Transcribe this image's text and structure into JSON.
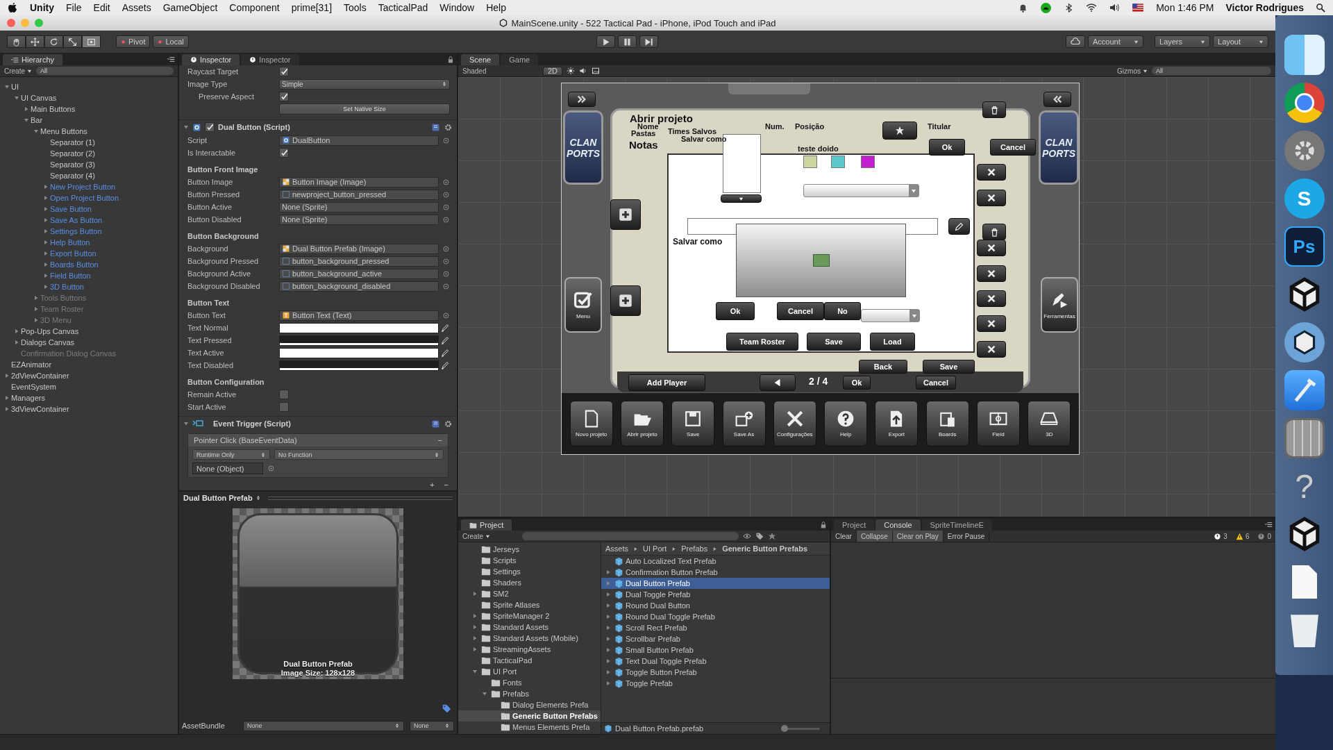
{
  "menubar": {
    "app": "Unity",
    "menus": [
      "File",
      "Edit",
      "Assets",
      "GameObject",
      "Component",
      "prime[31]",
      "Tools",
      "TacticalPad",
      "Window",
      "Help"
    ],
    "clock": "Mon 1:46 PM",
    "user": "Victor Rodrigues"
  },
  "window": {
    "title": "MainScene.unity - 522 Tactical Pad - iPhone, iPod Touch and iPad"
  },
  "toolbar": {
    "tools": [
      {
        "kind": "hand",
        "selected": false
      },
      {
        "kind": "move",
        "selected": false
      },
      {
        "kind": "rotate",
        "selected": false
      },
      {
        "kind": "scale",
        "selected": false
      },
      {
        "kind": "rect",
        "selected": true
      }
    ],
    "pivot": "Pivot",
    "space": "Local",
    "account": "Account",
    "layers": "Layers",
    "layout": "Layout"
  },
  "hierarchy": {
    "tab": "Hierarchy",
    "create": "Create",
    "search_placeholder": "All",
    "items": [
      {
        "label": "UI",
        "kind": "normal",
        "expanded": true,
        "children": [
          {
            "label": "UI Canvas",
            "kind": "normal",
            "expanded": true,
            "children": [
              {
                "label": "Main Buttons",
                "kind": "normal",
                "expanded": false
              },
              {
                "label": "Bar",
                "kind": "normal",
                "expanded": true,
                "children": [
                  {
                    "label": "Menu Buttons",
                    "kind": "normal",
                    "expanded": true,
                    "children": [
                      {
                        "label": "Separator (1)",
                        "kind": "normal"
                      },
                      {
                        "label": "Separator (2)",
                        "kind": "normal"
                      },
                      {
                        "label": "Separator (3)",
                        "kind": "normal"
                      },
                      {
                        "label": "Separator (4)",
                        "kind": "normal"
                      },
                      {
                        "label": "New Project Button",
                        "kind": "prefab",
                        "expanded": false
                      },
                      {
                        "label": "Open Project Button",
                        "kind": "prefab",
                        "expanded": false
                      },
                      {
                        "label": "Save Button",
                        "kind": "prefab",
                        "expanded": false
                      },
                      {
                        "label": "Save As Button",
                        "kind": "prefab",
                        "expanded": false
                      },
                      {
                        "label": "Settings Button",
                        "kind": "prefab",
                        "expanded": false
                      },
                      {
                        "label": "Help Button",
                        "kind": "prefab",
                        "expanded": false
                      },
                      {
                        "label": "Export Button",
                        "kind": "prefab",
                        "expanded": false
                      },
                      {
                        "label": "Boards Button",
                        "kind": "prefab",
                        "expanded": false
                      },
                      {
                        "label": "Field Button",
                        "kind": "prefab",
                        "expanded": false
                      },
                      {
                        "label": "3D Button",
                        "kind": "prefab",
                        "expanded": false
                      }
                    ]
                  },
                  {
                    "label": "Tools Buttons",
                    "kind": "inactive",
                    "expanded": false
                  },
                  {
                    "label": "Team Roster",
                    "kind": "inactive",
                    "expanded": false
                  },
                  {
                    "label": "3D Menu",
                    "kind": "inactive",
                    "expanded": false
                  }
                ]
              }
            ]
          },
          {
            "label": "Pop-Ups Canvas",
            "kind": "normal",
            "expanded": false
          },
          {
            "label": "Dialogs Canvas",
            "kind": "normal",
            "expanded": false
          },
          {
            "label": "Confirmation Dialog Canvas",
            "kind": "inactive"
          }
        ]
      },
      {
        "label": "EZAnimator",
        "kind": "normal"
      },
      {
        "label": "2dViewContainer",
        "kind": "normal",
        "expanded": false
      },
      {
        "label": "EventSystem",
        "kind": "normal"
      },
      {
        "label": "Managers",
        "kind": "normal",
        "expanded": false
      },
      {
        "label": "3dViewContainer",
        "kind": "normal",
        "expanded": false
      }
    ]
  },
  "inspector": {
    "tabs": [
      {
        "label": "Inspector",
        "selected": true
      },
      {
        "label": "Inspector",
        "selected": false
      }
    ],
    "image_rows": [
      {
        "kind": "check",
        "label": "Raycast Target",
        "checked": true
      },
      {
        "kind": "dropdown",
        "label": "Image Type",
        "value": "Simple"
      },
      {
        "kind": "subcheck",
        "label": "Preserve Aspect",
        "checked": true
      },
      {
        "kind": "button",
        "value": "Set Native Size"
      }
    ],
    "components": [
      {
        "title": "Dual Button (Script)",
        "kind": "script",
        "enabled": true,
        "rows": [
          {
            "kind": "object",
            "label": "Script",
            "value": "DualButton"
          },
          {
            "kind": "check",
            "label": "Is Interactable",
            "checked": true
          },
          {
            "kind": "header",
            "label": "Button Front Image"
          },
          {
            "kind": "object",
            "label": "Button Image",
            "value": "Button Image (Image)"
          },
          {
            "kind": "object",
            "label": "Button Pressed",
            "value": "newproject_button_pressed"
          },
          {
            "kind": "object",
            "label": "Button Active",
            "value": "None (Sprite)"
          },
          {
            "kind": "object",
            "label": "Button Disabled",
            "value": "None (Sprite)"
          },
          {
            "kind": "header",
            "label": "Button Background"
          },
          {
            "kind": "object",
            "label": "Background",
            "value": "Dual Button Prefab (Image)"
          },
          {
            "kind": "object",
            "label": "Background Pressed",
            "value": "button_background_pressed"
          },
          {
            "kind": "object",
            "label": "Background Active",
            "value": "button_background_active"
          },
          {
            "kind": "object",
            "label": "Background Disabled",
            "value": "button_background_disabled"
          },
          {
            "kind": "header",
            "label": "Button Text"
          },
          {
            "kind": "object",
            "label": "Button Text",
            "value": "Button Text (Text)"
          },
          {
            "kind": "color",
            "label": "Text Normal",
            "color": "#ffffff"
          },
          {
            "kind": "color",
            "label": "Text Pressed",
            "color": "#1e1e1e"
          },
          {
            "kind": "color",
            "label": "Text Active",
            "color": "#ffffff"
          },
          {
            "kind": "color",
            "label": "Text Disabled",
            "color": "#1e1e1e"
          },
          {
            "kind": "header",
            "label": "Button Configuration"
          },
          {
            "kind": "check",
            "label": "Remain Active",
            "checked": false
          },
          {
            "kind": "check",
            "label": "Start Active",
            "checked": false
          }
        ]
      },
      {
        "title": "Event Trigger (Script)",
        "kind": "event",
        "event": {
          "title": "Pointer Click (BaseEventData)",
          "remove": "−",
          "mode": "Runtime Only",
          "function": "No Function",
          "target": "None (Object)",
          "add": "+",
          "remove_last": "−"
        }
      }
    ],
    "preview": {
      "title": "Dual Button Prefab",
      "name": "Dual Button Prefab",
      "size": "Image Size: 128x128"
    },
    "assetbundle": {
      "label": "AssetBundle",
      "name": "None",
      "variant": "None"
    }
  },
  "scene": {
    "tabs": [
      {
        "label": "Scene",
        "selected": true
      },
      {
        "label": "Game",
        "selected": false
      }
    ],
    "shading": "Shaded",
    "mode_2d": "2D",
    "gizmos": "Gizmos",
    "search_placeholder": "All",
    "game": {
      "badges": [
        {
          "lines": [
            "CLAN",
            "PORTS"
          ]
        },
        {
          "lines": [
            "CLAN",
            "PORTS"
          ]
        }
      ],
      "labels": [
        "Abrir projeto",
        "Nome",
        "Pastas",
        "Times Salvos",
        "Salvar como",
        "Num.",
        "Posição",
        "Titular",
        "Notas",
        "teste doido",
        "Salvar como",
        "2 / 4"
      ],
      "buttons": [
        "Ok",
        "Cancel",
        "Ok",
        "Cancel",
        "No",
        "Team Roster",
        "Save",
        "Load",
        "Back",
        "Save",
        "Add Player",
        "Ok",
        "Cancel"
      ],
      "swatches": [
        {
          "color": "#cdd6a0"
        },
        {
          "color": "#5ec8cc"
        },
        {
          "color": "#c31fd1"
        }
      ],
      "side_buttons": [
        "Menu",
        "Ferramentas"
      ],
      "toolbar": [
        {
          "kind": "new",
          "label": "Novo projeto"
        },
        {
          "kind": "open",
          "label": "Abrir projeto"
        },
        {
          "kind": "save",
          "label": "Save"
        },
        {
          "kind": "saveas",
          "label": "Save As"
        },
        {
          "kind": "settings",
          "label": "Configurações"
        },
        {
          "kind": "help",
          "label": "Help"
        },
        {
          "kind": "export",
          "label": "Export"
        },
        {
          "kind": "boards",
          "label": "Boards"
        },
        {
          "kind": "field",
          "label": "Field"
        },
        {
          "kind": "stadium",
          "label": "3D"
        }
      ]
    }
  },
  "project": {
    "tab": "Project",
    "create": "Create",
    "folders": [
      {
        "label": "Jerseys",
        "selected": false
      },
      {
        "label": "Scripts",
        "selected": false
      },
      {
        "label": "Settings",
        "selected": false
      },
      {
        "label": "Shaders",
        "selected": false
      },
      {
        "label": "SM2",
        "selected": false,
        "expanded": false
      },
      {
        "label": "Sprite Atlases",
        "selected": false
      },
      {
        "label": "SpriteManager 2",
        "selected": false,
        "expanded": false
      },
      {
        "label": "Standard Assets",
        "selected": false,
        "expanded": false
      },
      {
        "label": "Standard Assets (Mobile)",
        "selected": false,
        "expanded": false
      },
      {
        "label": "StreamingAssets",
        "selected": false,
        "expanded": false
      },
      {
        "label": "TacticalPad",
        "selected": false
      },
      {
        "label": "UI Port",
        "selected": false,
        "expanded": true,
        "children": [
          {
            "label": "Fonts",
            "selected": false
          },
          {
            "label": "Prefabs",
            "selected": false,
            "expanded": true,
            "children": [
              {
                "label": "Dialog Elements Prefa",
                "selected": false
              },
              {
                "label": "Generic Button Prefabs",
                "selected": true
              },
              {
                "label": "Menus Elements Prefa",
                "selected": false
              }
            ]
          }
        ]
      }
    ],
    "breadcrumb": [
      "Assets",
      "UI Port",
      "Prefabs",
      "Generic Button Prefabs"
    ],
    "assets": [
      {
        "label": "Auto Localized Text Prefab",
        "selected": false
      },
      {
        "label": "Confirmation Button Prefab",
        "selected": false,
        "expanded": false
      },
      {
        "label": "Dual Button Prefab",
        "selected": true,
        "expanded": false
      },
      {
        "label": "Dual Toggle Prefab",
        "selected": false,
        "expanded": false
      },
      {
        "label": "Round Dual Button",
        "selected": false,
        "expanded": false
      },
      {
        "label": "Round Dual Toggle Prefab",
        "selected": false,
        "expanded": false
      },
      {
        "label": "Scroll Rect Prefab",
        "selected": false,
        "expanded": false
      },
      {
        "label": "Scrollbar Prefab",
        "selected": false,
        "expanded": false
      },
      {
        "label": "Small Button Prefab",
        "selected": false,
        "expanded": false
      },
      {
        "label": "Text Dual Toggle Prefab",
        "selected": false,
        "expanded": false
      },
      {
        "label": "Toggle Button Prefab",
        "selected": false,
        "expanded": false
      },
      {
        "label": "Toggle Prefab",
        "selected": false,
        "expanded": false
      }
    ],
    "footer": "Dual Button Prefab.prefab",
    "icon_size": {
      "level": 0
    }
  },
  "console": {
    "tabs": [
      {
        "label": "Project",
        "selected": false
      },
      {
        "label": "Console",
        "selected": true
      },
      {
        "label": "SpriteTimelineE",
        "selected": false
      }
    ],
    "buttons": [
      {
        "label": "Clear",
        "on": false
      },
      {
        "label": "Collapse",
        "on": true
      },
      {
        "label": "Clear on Play",
        "on": true
      },
      {
        "label": "Error Pause",
        "on": false
      }
    ],
    "counts": [
      {
        "kind": "info",
        "count": "3"
      },
      {
        "kind": "warning",
        "count": "6"
      },
      {
        "kind": "error",
        "count": "0"
      }
    ]
  },
  "dock": [
    {
      "kind": "finder"
    },
    {
      "kind": "chrome"
    },
    {
      "kind": "gear"
    },
    {
      "kind": "letter",
      "text": "S"
    },
    {
      "kind": "ps",
      "text": "Ps"
    },
    {
      "kind": "unity"
    },
    {
      "kind": "ring"
    },
    {
      "kind": "xcode"
    },
    {
      "kind": "calculator"
    },
    {
      "kind": "help",
      "text": "?"
    },
    {
      "kind": "unity"
    },
    {
      "kind": "document"
    },
    {
      "kind": "trash"
    }
  ]
}
